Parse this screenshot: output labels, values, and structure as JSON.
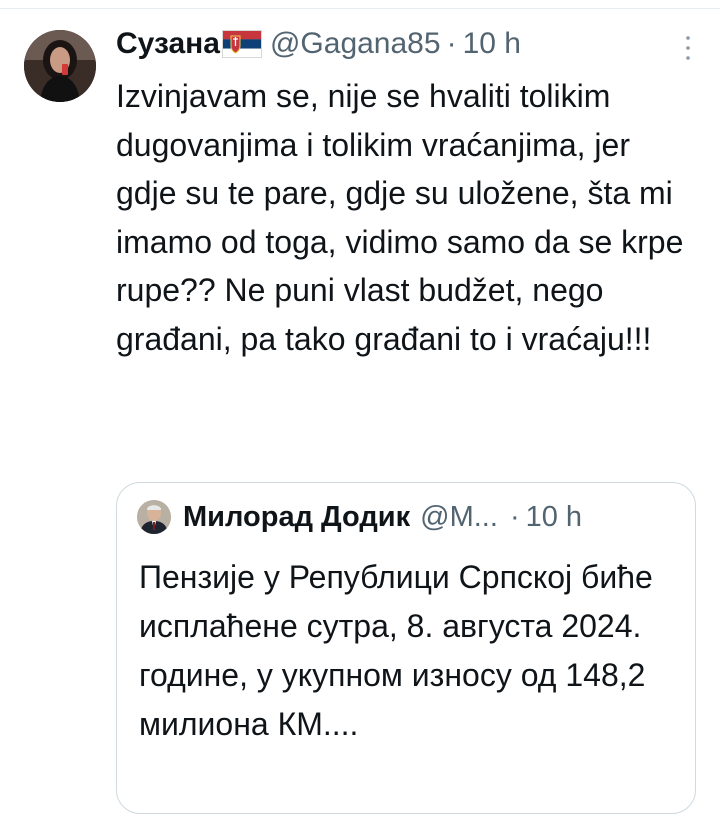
{
  "tweet": {
    "author": {
      "display_name": "Сузана",
      "flag_icon": "serbia-flag-icon",
      "handle": "@Gagana85",
      "separator": "·",
      "time": "10 h"
    },
    "text": "Izvinjavam se, nije se hvaliti tolikim dugovanjima i tolikim vraćanjima, jer gdje su te pare, gdje su uložene, šta mi imamo od toga, vidimo samo da se krpe rupe?? Ne puni vlast budžet, nego građani, pa tako građani to i vraćaju!!!",
    "more_icon": "more-vertical-icon"
  },
  "quote": {
    "author": {
      "display_name": "Милорад Додик",
      "handle": "@M...",
      "separator": "·",
      "time": "10 h"
    },
    "text": "Пензије у Републици Српској биће исплаћене сутра, 8. августа 2024. године, у укупном износу од 148,2 милиона КМ...."
  },
  "colors": {
    "text_primary": "#0f1419",
    "text_secondary": "#536471",
    "border": "#cfd9de"
  }
}
